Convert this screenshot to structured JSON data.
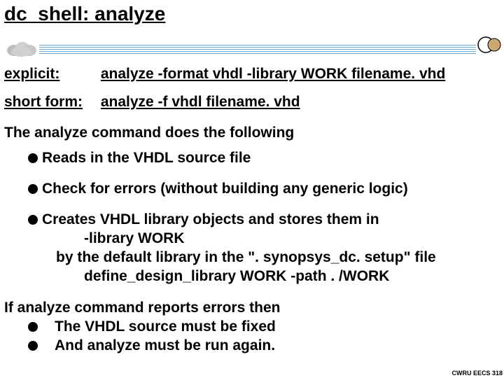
{
  "title": "dc_shell: analyze",
  "rows": {
    "explicit_label": "explicit:",
    "explicit_value": "analyze -format vhdl -library WORK filename. vhd",
    "short_label": "short form:",
    "short_value": "analyze -f vhdl filename. vhd"
  },
  "intro": "The analyze command does the following",
  "bullets": {
    "b1": "Reads in the VHDL source file",
    "b2": "Check for errors (without building any generic logic)",
    "b3": "Creates VHDL library objects and stores them in"
  },
  "sublines": {
    "s1": "-library WORK",
    "s2": "by the default library in the \". synopsys_dc. setup\" file",
    "s3": "define_design_library WORK -path . /WORK"
  },
  "closing": "If analyze command reports errors then",
  "closing_bullets": {
    "c1": "The VHDL source must be fixed",
    "c2": "And analyze must be run again."
  },
  "footer": "CWRU EECS 318"
}
